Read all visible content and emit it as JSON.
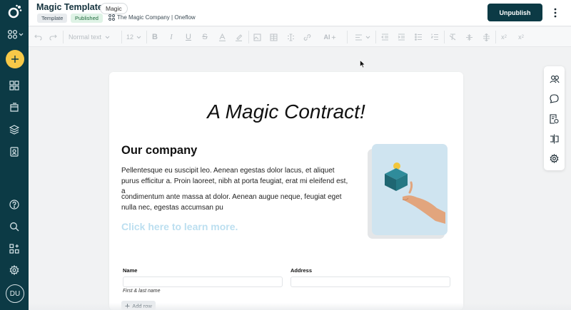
{
  "app": {
    "title": "Magic Template",
    "tag": "Magic",
    "status_pills": [
      "Template",
      "Published"
    ],
    "company": "The Magic Company | Oneflow",
    "primary_action": "Unpublish"
  },
  "rail": {
    "avatar_initials": "DU",
    "icons": [
      "oneflow-logo-icon",
      "workspace-switcher-icon",
      "create-plus-icon",
      "dashboard-grid-icon",
      "folder-icon",
      "templates-layers-icon",
      "contacts-icon",
      "help-icon",
      "search-icon",
      "marketplace-icon",
      "settings-gear-icon"
    ]
  },
  "toolbar": {
    "text_style": "Normal text",
    "font_size": "12",
    "icons": [
      "undo-icon",
      "redo-icon",
      "bold-icon",
      "italic-icon",
      "underline-icon",
      "strikethrough-icon",
      "text-color-icon",
      "highlight-icon",
      "image-icon",
      "table-icon",
      "form-field-icon",
      "link-icon",
      "ai-assist-icon",
      "align-icon",
      "outdent-icon",
      "indent-icon",
      "bullet-list-icon",
      "numbered-list-icon",
      "clear-format-icon",
      "vertical-align-icon",
      "line-height-icon",
      "superscript-icon",
      "subscript-icon"
    ],
    "ai_label": "AI"
  },
  "document": {
    "heading": "A Magic Contract!",
    "section_title": "Our company",
    "paragraph_1": "Pellentesque eu suscipit leo. Aenean egestas dolor lacus, et aliquet purus efficitur a. Proin laoreet, nibh at porta feugiat, erat mi eleifend est, a",
    "paragraph_2": "condimentum ante massa at dolor. Aenean augue neque, feugiat eget nulla nec, egestas accumsan pu",
    "link_text": "Click here to learn more.",
    "form": {
      "name_label": "Name",
      "address_label": "Address",
      "name_hint": "First & last name",
      "add_row": "Add row"
    }
  },
  "right_panel": {
    "icons": [
      "participants-icon",
      "comments-icon",
      "document-settings-icon",
      "sections-icon",
      "settings-gear-icon"
    ]
  },
  "colors": {
    "brand": "#0c3a45",
    "accent": "#f7c948",
    "link": "#bcdff0"
  }
}
